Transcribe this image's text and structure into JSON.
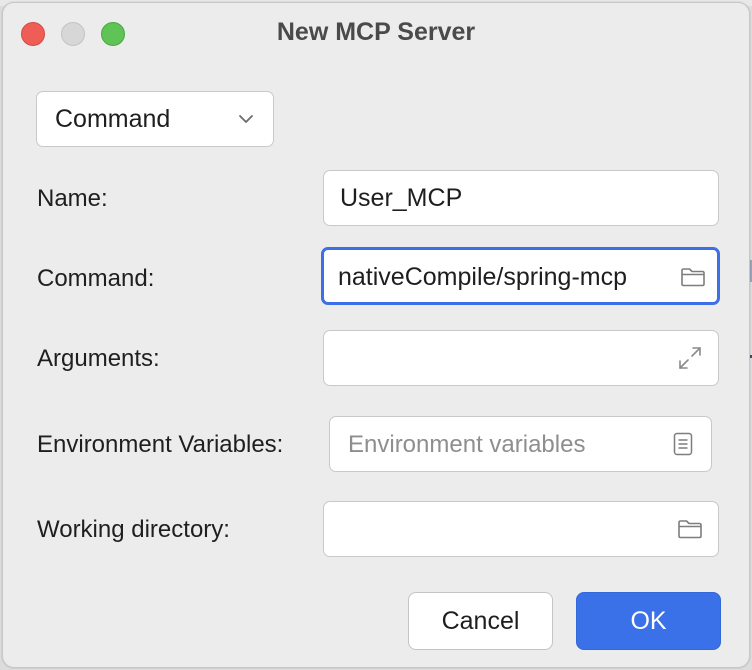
{
  "window": {
    "title": "New MCP Server"
  },
  "type_select": {
    "selected": "Command"
  },
  "form": {
    "name_label": "Name:",
    "name_value": "User_MCP",
    "command_label": "Command:",
    "command_value": "nativeCompile/spring-mcp",
    "arguments_label": "Arguments:",
    "arguments_value": "",
    "env_label": "Environment Variables:",
    "env_placeholder": "Environment variables",
    "workdir_label": "Working directory:",
    "workdir_value": ""
  },
  "buttons": {
    "cancel": "Cancel",
    "ok": "OK"
  },
  "icons": {
    "command_browse": "folder-icon",
    "arguments_expand": "expand-icon",
    "env_edit": "document-list-icon",
    "workdir_browse": "folder-icon",
    "dropdown": "chevron-down-icon"
  },
  "colors": {
    "accent": "#3b71e8",
    "close": "#ee5e57",
    "zoom": "#5fc355"
  }
}
